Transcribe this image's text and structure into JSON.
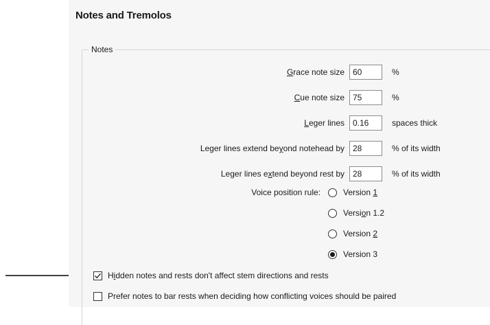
{
  "section": {
    "title": "Notes and Tremolos"
  },
  "notes_group": {
    "legend": "Notes",
    "grace_note_size": {
      "label_pre": "",
      "label_key": "G",
      "label_post": "race note size",
      "value": "60",
      "unit": "%"
    },
    "cue_note_size": {
      "label_pre": "",
      "label_key": "C",
      "label_post": "ue note size",
      "value": "75",
      "unit": "%"
    },
    "leger_lines": {
      "label_pre": "",
      "label_key": "L",
      "label_post": "eger lines",
      "value": "0.16",
      "unit": "spaces thick"
    },
    "leger_notehead": {
      "label_pre": "Leger lines extend be",
      "label_key": "y",
      "label_post": "ond notehead by",
      "value": "28",
      "unit": "% of its width"
    },
    "leger_rest": {
      "label_pre": "Leger lines e",
      "label_key": "x",
      "label_post": "tend beyond rest by",
      "value": "28",
      "unit": "% of its width"
    },
    "voice_position": {
      "label": "Voice position rule:",
      "options": [
        {
          "pre": "Version ",
          "key": "1",
          "post": "",
          "selected": false
        },
        {
          "pre": "Versi",
          "key": "o",
          "post": "n 1.2",
          "selected": false
        },
        {
          "pre": "Version ",
          "key": "2",
          "post": "",
          "selected": false
        },
        {
          "pre": "Version 3",
          "key": "",
          "post": "",
          "selected": true
        }
      ]
    }
  },
  "checkboxes": [
    {
      "pre": "H",
      "key": "i",
      "post": "dden notes and rests don't affect stem directions and rests",
      "checked": true
    },
    {
      "pre": "Prefer notes to bar rests when deciding how conflicting voices should be paired",
      "key": "",
      "post": "",
      "checked": false
    }
  ],
  "icons": {
    "arrow": "arrow-right-icon",
    "check": "checkmark-icon"
  },
  "colors": {
    "panel_bg": "#f6f6f6",
    "text": "#1a1a1a",
    "field_border": "#8c8c8c"
  }
}
